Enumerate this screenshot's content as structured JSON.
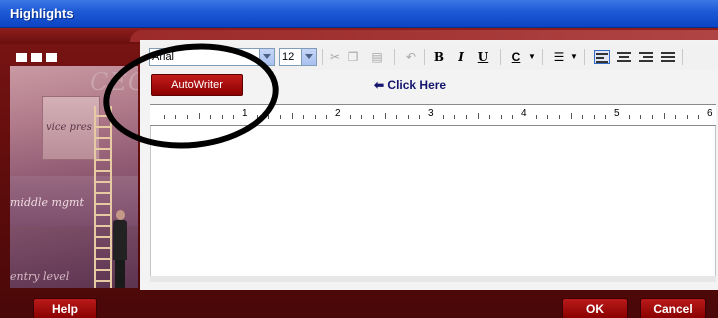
{
  "window": {
    "title": "Highlights"
  },
  "art": {
    "ceo_text": "CEO",
    "vp_text": "vice pres",
    "mm_text": "middle mgmt",
    "el_text": "entry level"
  },
  "toolbar": {
    "font_value": "Arial",
    "size_value": "12",
    "cut_icon": "scissors-icon",
    "copy_icon": "copy-icon",
    "paste_icon": "paste-icon",
    "undo_icon": "undo-icon",
    "bold_label": "B",
    "italic_label": "I",
    "underline_label": "U",
    "color_label": "C",
    "list_label": "☰"
  },
  "autowriter": {
    "label": "AutoWriter"
  },
  "hint": {
    "arrow": "⬅",
    "text": "Click Here"
  },
  "ruler": {
    "numbers": [
      "1",
      "2",
      "3",
      "4",
      "5",
      "6"
    ]
  },
  "buttons": {
    "help": "Help",
    "ok": "OK",
    "cancel": "Cancel"
  },
  "colors": {
    "frame": "#5a0b0b",
    "button": "#a60d0d",
    "titlebar": "#0b44c4"
  }
}
